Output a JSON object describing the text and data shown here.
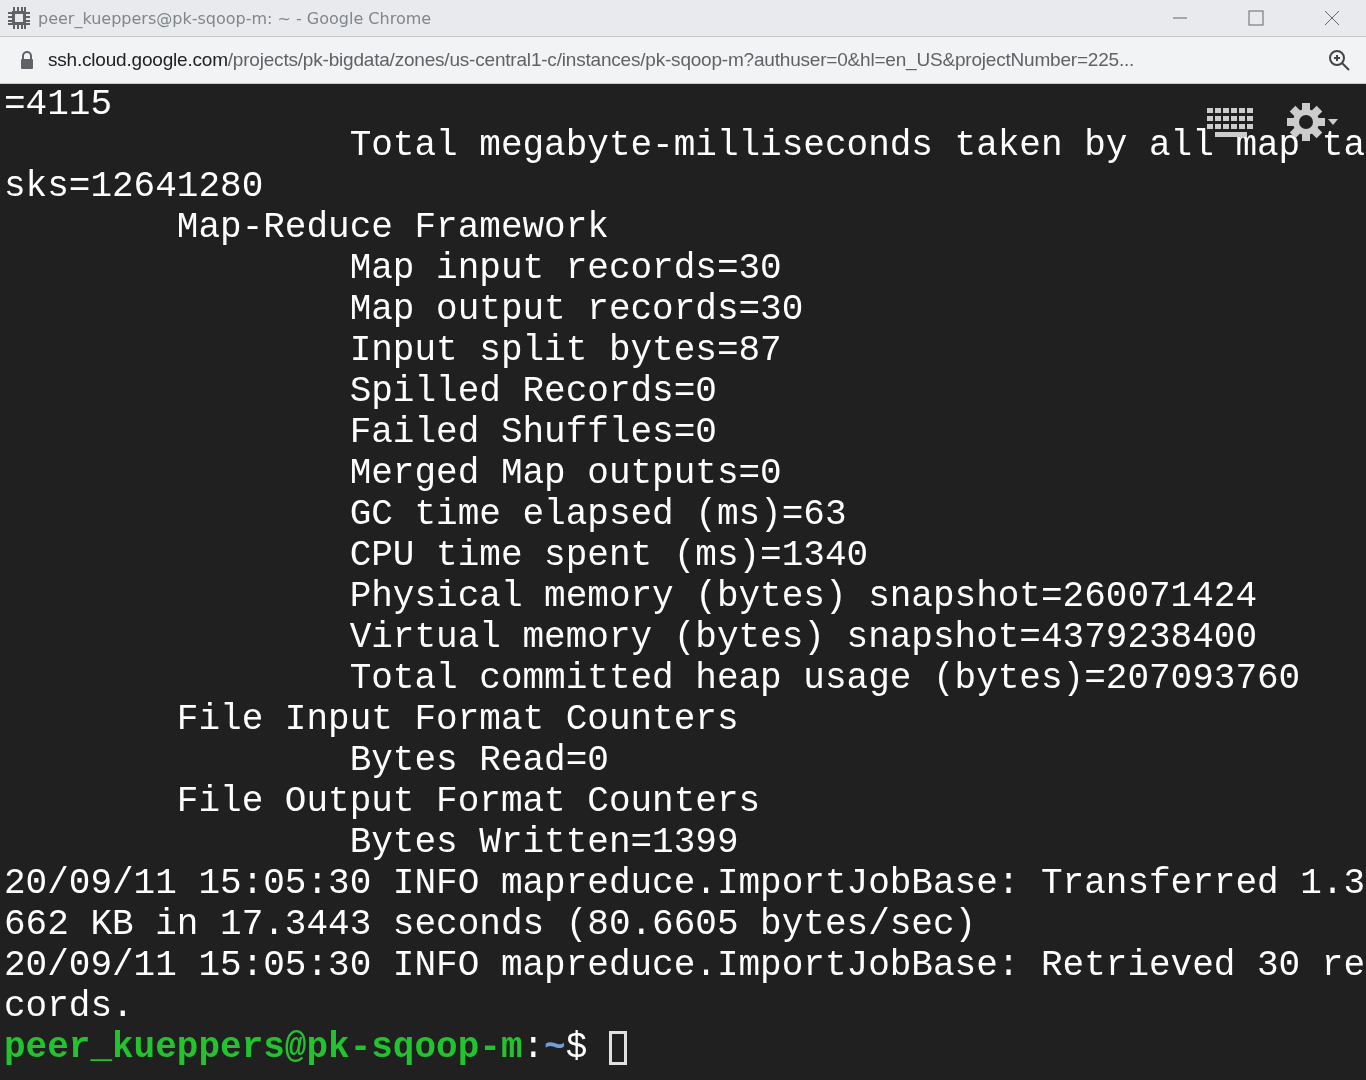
{
  "window": {
    "title": "peer_kueppers@pk-sqoop-m: ~ - Google Chrome"
  },
  "address_bar": {
    "host": "ssh.cloud.google.com",
    "path": "/projects/pk-bigdata/zones/us-central1-c/instances/pk-sqoop-m?authuser=0&hl=en_US&projectNumber=225..."
  },
  "terminal": {
    "lines": [
      "=4115",
      "\t\tTotal megabyte-milliseconds taken by all map ta",
      "sks=12641280",
      "\tMap-Reduce Framework",
      "\t\tMap input records=30",
      "\t\tMap output records=30",
      "\t\tInput split bytes=87",
      "\t\tSpilled Records=0",
      "\t\tFailed Shuffles=0",
      "\t\tMerged Map outputs=0",
      "\t\tGC time elapsed (ms)=63",
      "\t\tCPU time spent (ms)=1340",
      "\t\tPhysical memory (bytes) snapshot=260071424",
      "\t\tVirtual memory (bytes) snapshot=4379238400",
      "\t\tTotal committed heap usage (bytes)=207093760",
      "\tFile Input Format Counters",
      "\t\tBytes Read=0",
      "\tFile Output Format Counters",
      "\t\tBytes Written=1399",
      "20/09/11 15:05:30 INFO mapreduce.ImportJobBase: Transferred 1.3",
      "662 KB in 17.3443 seconds (80.6605 bytes/sec)",
      "20/09/11 15:05:30 INFO mapreduce.ImportJobBase: Retrieved 30 re",
      "cords."
    ],
    "prompt": {
      "user_host": "peer_kueppers@pk-sqoop-m",
      "separator": ":",
      "path": "~",
      "symbol": "$"
    }
  }
}
